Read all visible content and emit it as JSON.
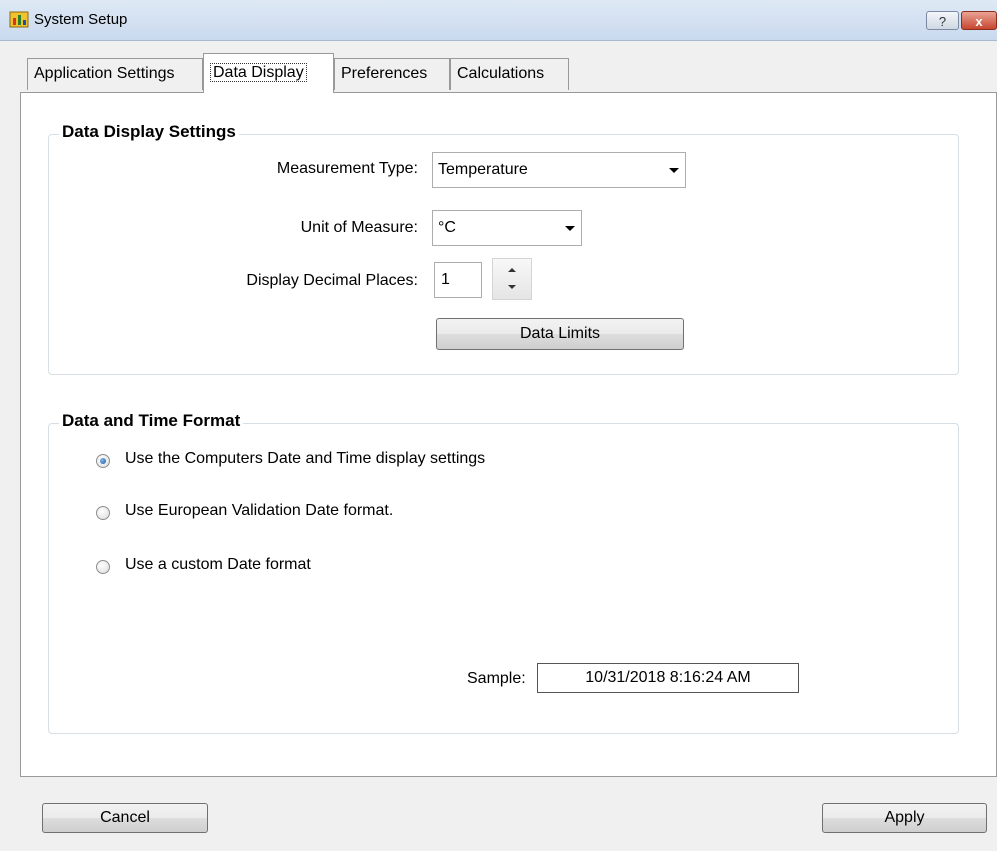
{
  "window": {
    "title": "System Setup",
    "help_label": "?",
    "close_label": "x"
  },
  "tabs": [
    {
      "label": "Application Settings",
      "active": false
    },
    {
      "label": "Data Display",
      "active": true
    },
    {
      "label": "Preferences",
      "active": false
    },
    {
      "label": "Calculations",
      "active": false
    }
  ],
  "data_display": {
    "group_title": "Data Display Settings",
    "measurement_type": {
      "label": "Measurement Type:",
      "value": "Temperature"
    },
    "unit_of_measure": {
      "label": "Unit of Measure:",
      "value": "°C"
    },
    "decimal_places": {
      "label": "Display Decimal Places:",
      "value": "1"
    },
    "data_limits_label": "Data Limits"
  },
  "date_time": {
    "group_title": "Data and Time Format",
    "options": [
      {
        "label": "Use the Computers Date and Time display settings",
        "checked": true
      },
      {
        "label": "Use European Validation Date format.",
        "checked": false
      },
      {
        "label": "Use a custom Date format",
        "checked": false
      }
    ],
    "sample_label": "Sample:",
    "sample_value": "10/31/2018 8:16:24 AM"
  },
  "footer": {
    "cancel_label": "Cancel",
    "apply_label": "Apply"
  },
  "colors": {
    "titlebar": "#c9d9ee",
    "close_button": "#c7462f",
    "radio_dot": "#1a5aa6"
  }
}
